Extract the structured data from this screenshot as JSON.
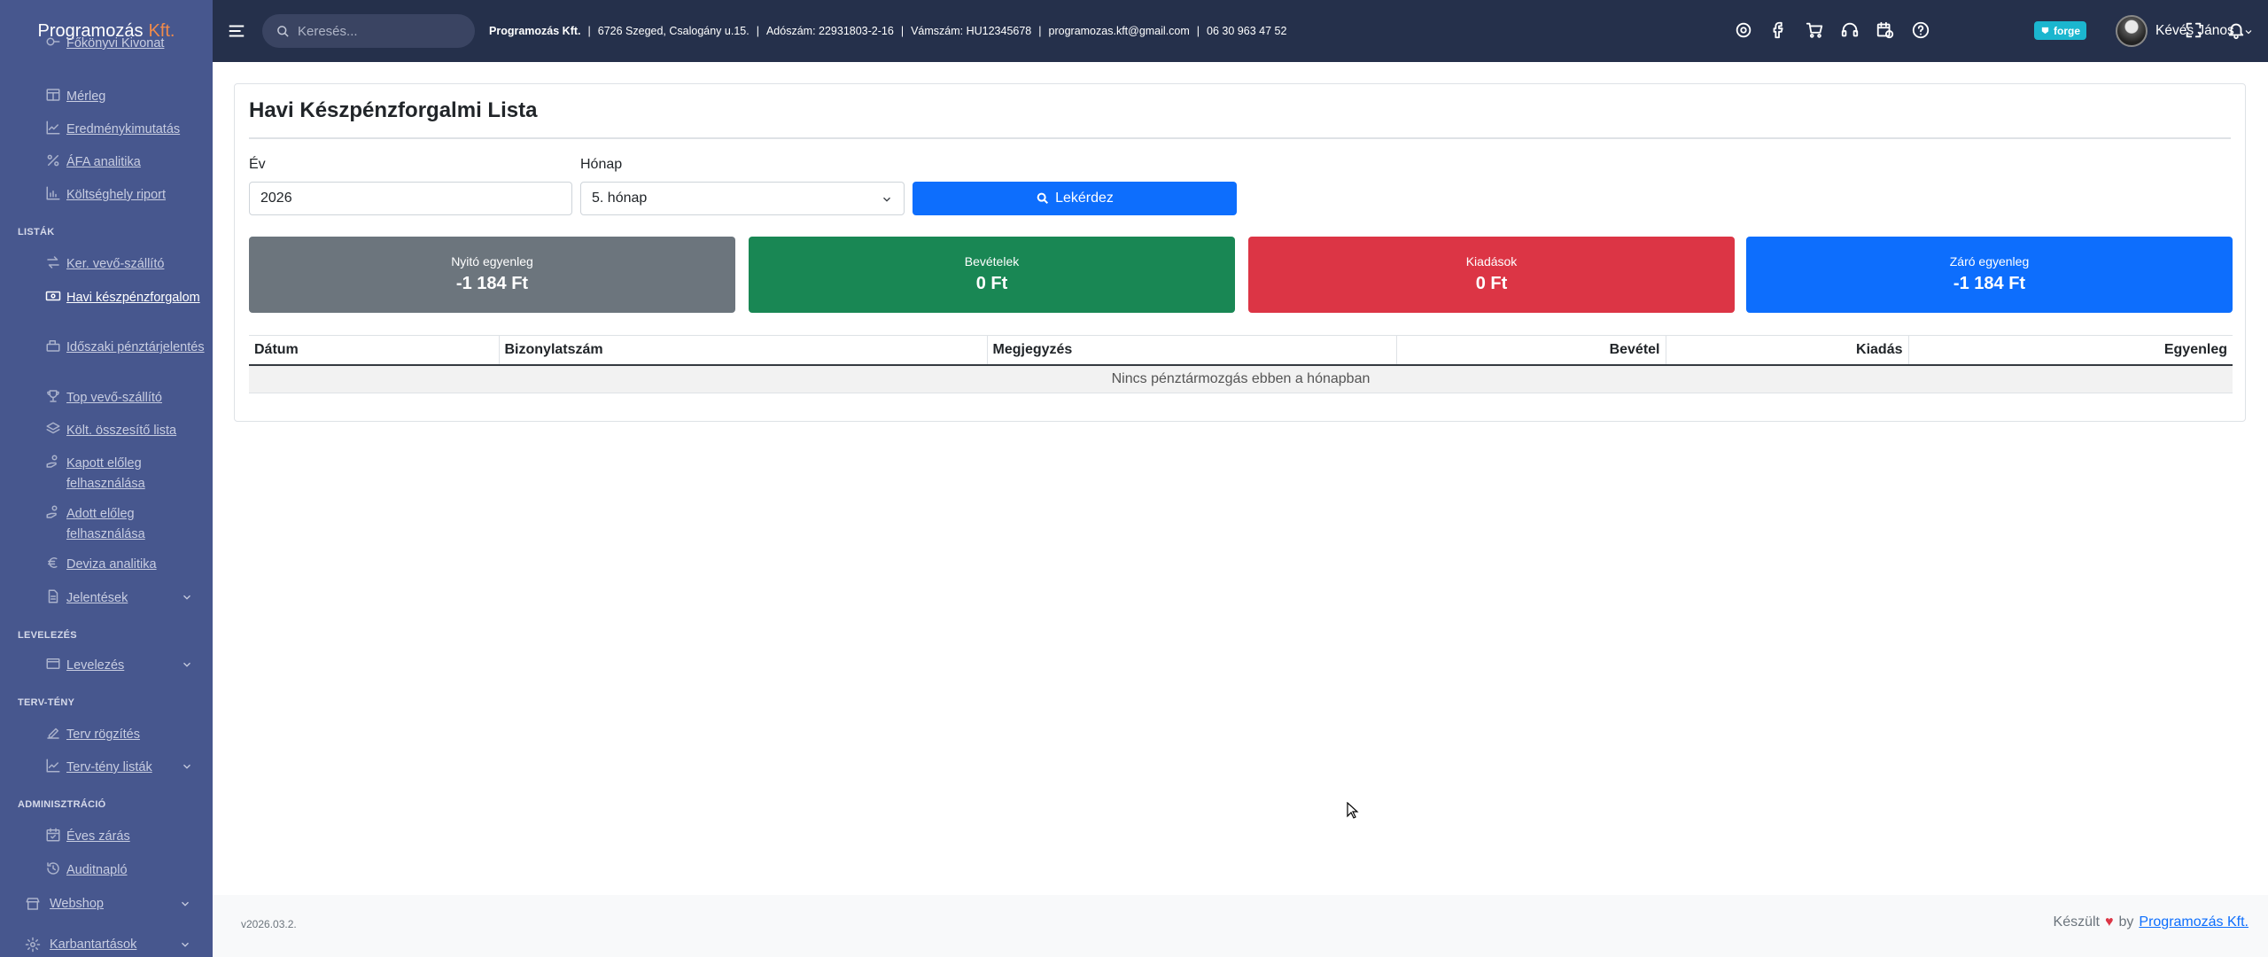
{
  "brand": {
    "name": "Programozás",
    "suffix": "Kft."
  },
  "sidebar": {
    "items_top": [
      {
        "label": "Főkönyvi Kivonat",
        "icon": "ledger-icon"
      },
      {
        "label": "Mérleg",
        "icon": "table-icon"
      },
      {
        "label": "Eredménykimutatás",
        "icon": "chart-line-icon"
      },
      {
        "label": "ÁFA analitika",
        "icon": "percent-icon"
      },
      {
        "label": "Költséghely riport",
        "icon": "chart-bar-icon"
      }
    ],
    "heading_lists": "LISTÁK",
    "items_lists": [
      {
        "label": "Ker. vevő-szállító",
        "icon": "exchange-icon"
      },
      {
        "label": "Havi készpénzforgalom",
        "icon": "money-icon"
      },
      {
        "label": "Időszaki pénztárjelentés",
        "icon": "cash-register-icon"
      },
      {
        "label": "Top vevő-szállító",
        "icon": "trophy-icon"
      },
      {
        "label": "Költ. összesítő lista",
        "icon": "layers-icon"
      },
      {
        "label": "Kapott előleg felhasználása",
        "icon": "hand-coin-icon"
      },
      {
        "label": "Adott előleg felhasználása",
        "icon": "hand-coin-icon"
      },
      {
        "label": "Deviza analitika",
        "icon": "euro-icon"
      },
      {
        "label": "Jelentések",
        "icon": "document-icon"
      }
    ],
    "heading_mail": "LEVELEZÉS",
    "items_mail": [
      {
        "label": "Levelezés",
        "icon": "envelope-icon"
      }
    ],
    "heading_plan": "TERV-TÉNY",
    "items_plan": [
      {
        "label": "Terv rögzítés",
        "icon": "edit-icon"
      },
      {
        "label": "Terv-tény listák",
        "icon": "chart-line-icon"
      }
    ],
    "heading_admin": "ADMINISZTRÁCIÓ",
    "items_admin": [
      {
        "label": "Éves zárás",
        "icon": "calendar-check-icon"
      },
      {
        "label": "Auditnapló",
        "icon": "history-icon"
      }
    ],
    "items_bottom": [
      {
        "label": "Webshop",
        "icon": "store-icon"
      },
      {
        "label": "Karbantartások",
        "icon": "gear-icon"
      }
    ]
  },
  "topbar": {
    "search_placeholder": "Keresés...",
    "company": "Programozás Kft.",
    "address": "6726 Szeged, Csalogány u.15.",
    "tax_number": "Adószám: 22931803-2-16",
    "vat_number": "Vámszám: HU12345678",
    "email": "programozas.kft@gmail.com",
    "phone": "06 30 963 47 52",
    "badge": "forge",
    "user_name": "Kévés János"
  },
  "page": {
    "title": "Havi Készpénzforgalmi Lista",
    "year_label": "Év",
    "year_value": "2026",
    "month_label": "Hónap",
    "month_value": "5. hónap",
    "query_button": "Lekérdez",
    "stats": [
      {
        "label": "Nyitó egyenleg",
        "value": "-1 184 Ft",
        "color": "#6c757d"
      },
      {
        "label": "Bevételek",
        "value": "0 Ft",
        "color": "#198754"
      },
      {
        "label": "Kiadások",
        "value": "0 Ft",
        "color": "#dc3545"
      },
      {
        "label": "Záró egyenleg",
        "value": "-1 184 Ft",
        "color": "#0d6efd"
      }
    ],
    "table": {
      "columns": [
        "Dátum",
        "Bizonylatszám",
        "Megjegyzés",
        "Bevétel",
        "Kiadás",
        "Egyenleg"
      ],
      "empty_message": "Nincs pénztármozgás ebben a hónapban"
    }
  },
  "footer": {
    "version": "v2026.03.2.",
    "made_prefix": "Készült",
    "made_by": "by",
    "made_link": "Programozás Kft."
  }
}
